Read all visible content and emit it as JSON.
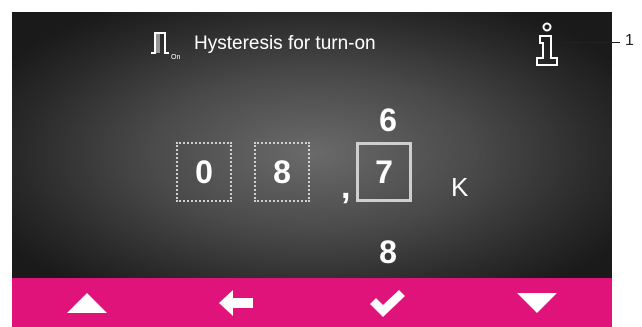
{
  "header": {
    "title": "Hysteresis for turn-on",
    "icon": "hysteresis-on-icon",
    "icon_sub_label": "On"
  },
  "info": {
    "icon": "info-icon",
    "callout_number": "1"
  },
  "value_editor": {
    "digits": [
      "0",
      "8",
      "7"
    ],
    "separator": ",",
    "unit": "K",
    "active_digit_index": 2,
    "spinner_up_value": "6",
    "spinner_down_value": "8"
  },
  "toolbar": {
    "buttons": [
      {
        "name": "up",
        "icon": "triangle-up-icon"
      },
      {
        "name": "back",
        "icon": "arrow-left-icon"
      },
      {
        "name": "confirm",
        "icon": "checkmark-icon"
      },
      {
        "name": "down",
        "icon": "triangle-down-icon"
      }
    ],
    "color": "#e0137a"
  }
}
